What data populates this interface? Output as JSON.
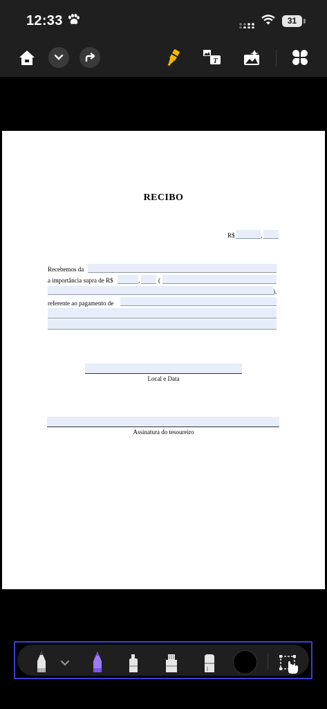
{
  "status": {
    "time": "12:33",
    "battery": "31"
  },
  "toolbar": {
    "icons": [
      "home-icon",
      "chevron-down-icon",
      "redo-icon",
      "highlighter-icon",
      "text-box-icon",
      "image-edit-icon",
      "apps-grid-icon"
    ]
  },
  "document": {
    "title": "RECIBO",
    "currency_label": "R$",
    "decimal_sep": ",",
    "received_from_label": "Recebemos da",
    "amount_label": "a importância supra de R$",
    "paren_open": "(",
    "paren_close": "),",
    "reference_label": "referente ao pagamento de",
    "place_date_label": "Local e Data",
    "signature_label": "Assinatura do tesoureiro"
  },
  "tools": {
    "items": [
      "pencil-tool",
      "chevron-down-icon",
      "pen-tool-selected",
      "marker-tool",
      "highlighter-tool",
      "eraser-tool",
      "color-picker",
      "lasso-select-tool"
    ],
    "accent": "#9a7cf5",
    "frame": "#3f3fd6"
  }
}
